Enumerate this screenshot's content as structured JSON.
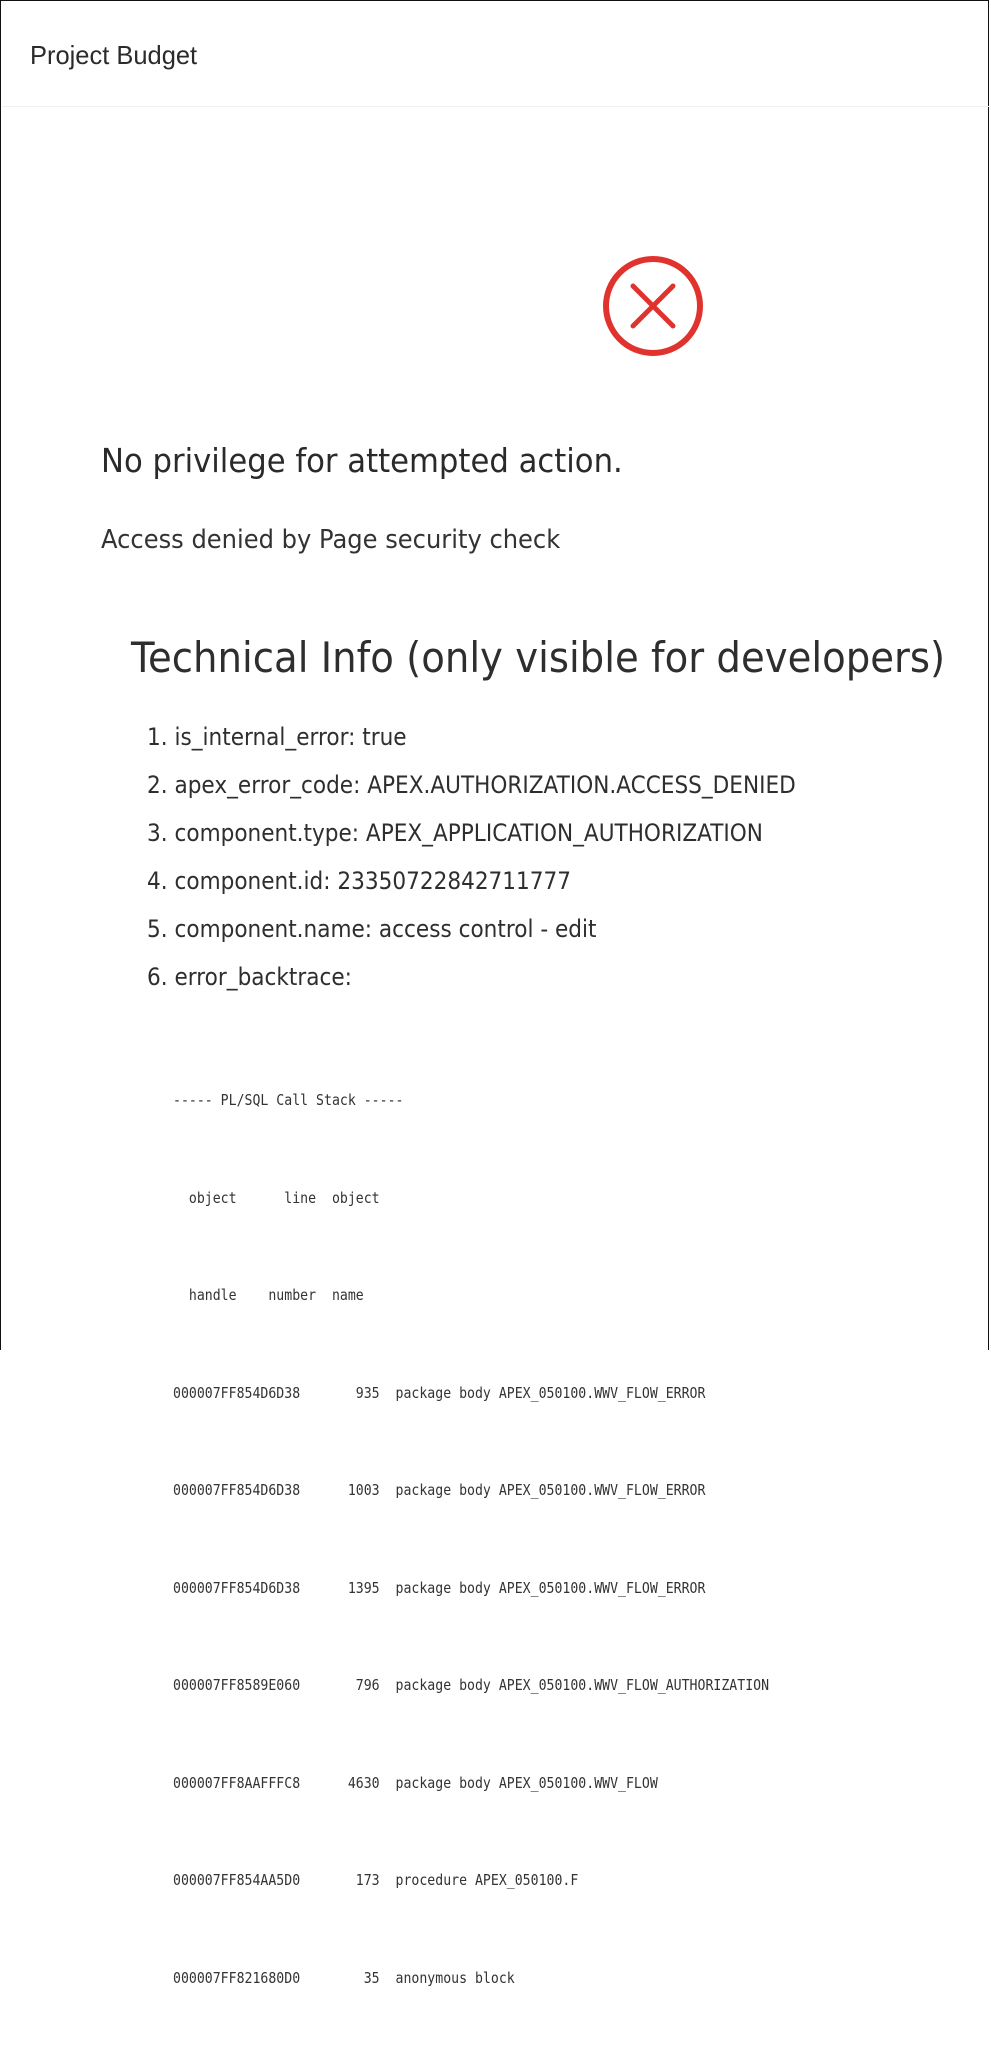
{
  "header": {
    "title": "Project Budget"
  },
  "error": {
    "icon": "error-circle-x-icon",
    "icon_color": "#e1332e",
    "message": "No privilege for attempted action.",
    "detail": "Access denied by Page security check"
  },
  "technical_info": {
    "title": "Technical Info (only visible for developers)",
    "items": [
      {
        "text": "1. is_internal_error: true"
      },
      {
        "text": "2. apex_error_code: APEX.AUTHORIZATION.ACCESS_DENIED"
      },
      {
        "text": "3. component.type: APEX_APPLICATION_AUTHORIZATION"
      },
      {
        "text": "4. component.id: 23350722842711777"
      },
      {
        "text": "5. component.name: access control - edit"
      },
      {
        "text": "6. error_backtrace:"
      }
    ],
    "backtrace": {
      "header_line": "----- PL/SQL Call Stack -----",
      "col_header_1": "  object      line  object",
      "col_header_2": "  handle    number  name",
      "rows": [
        {
          "text": "000007FF854D6D38       935  package body APEX_050100.WWV_FLOW_ERROR"
        },
        {
          "text": "000007FF854D6D38      1003  package body APEX_050100.WWV_FLOW_ERROR"
        },
        {
          "text": "000007FF854D6D38      1395  package body APEX_050100.WWV_FLOW_ERROR"
        },
        {
          "text": "000007FF8589E060       796  package body APEX_050100.WWV_FLOW_AUTHORIZATION"
        },
        {
          "text": "000007FF8AAFFFC8      4630  package body APEX_050100.WWV_FLOW"
        },
        {
          "text": "000007FF854AA5D0       173  procedure APEX_050100.F"
        },
        {
          "text": "000007FF821680D0        35  anonymous block"
        }
      ]
    }
  }
}
